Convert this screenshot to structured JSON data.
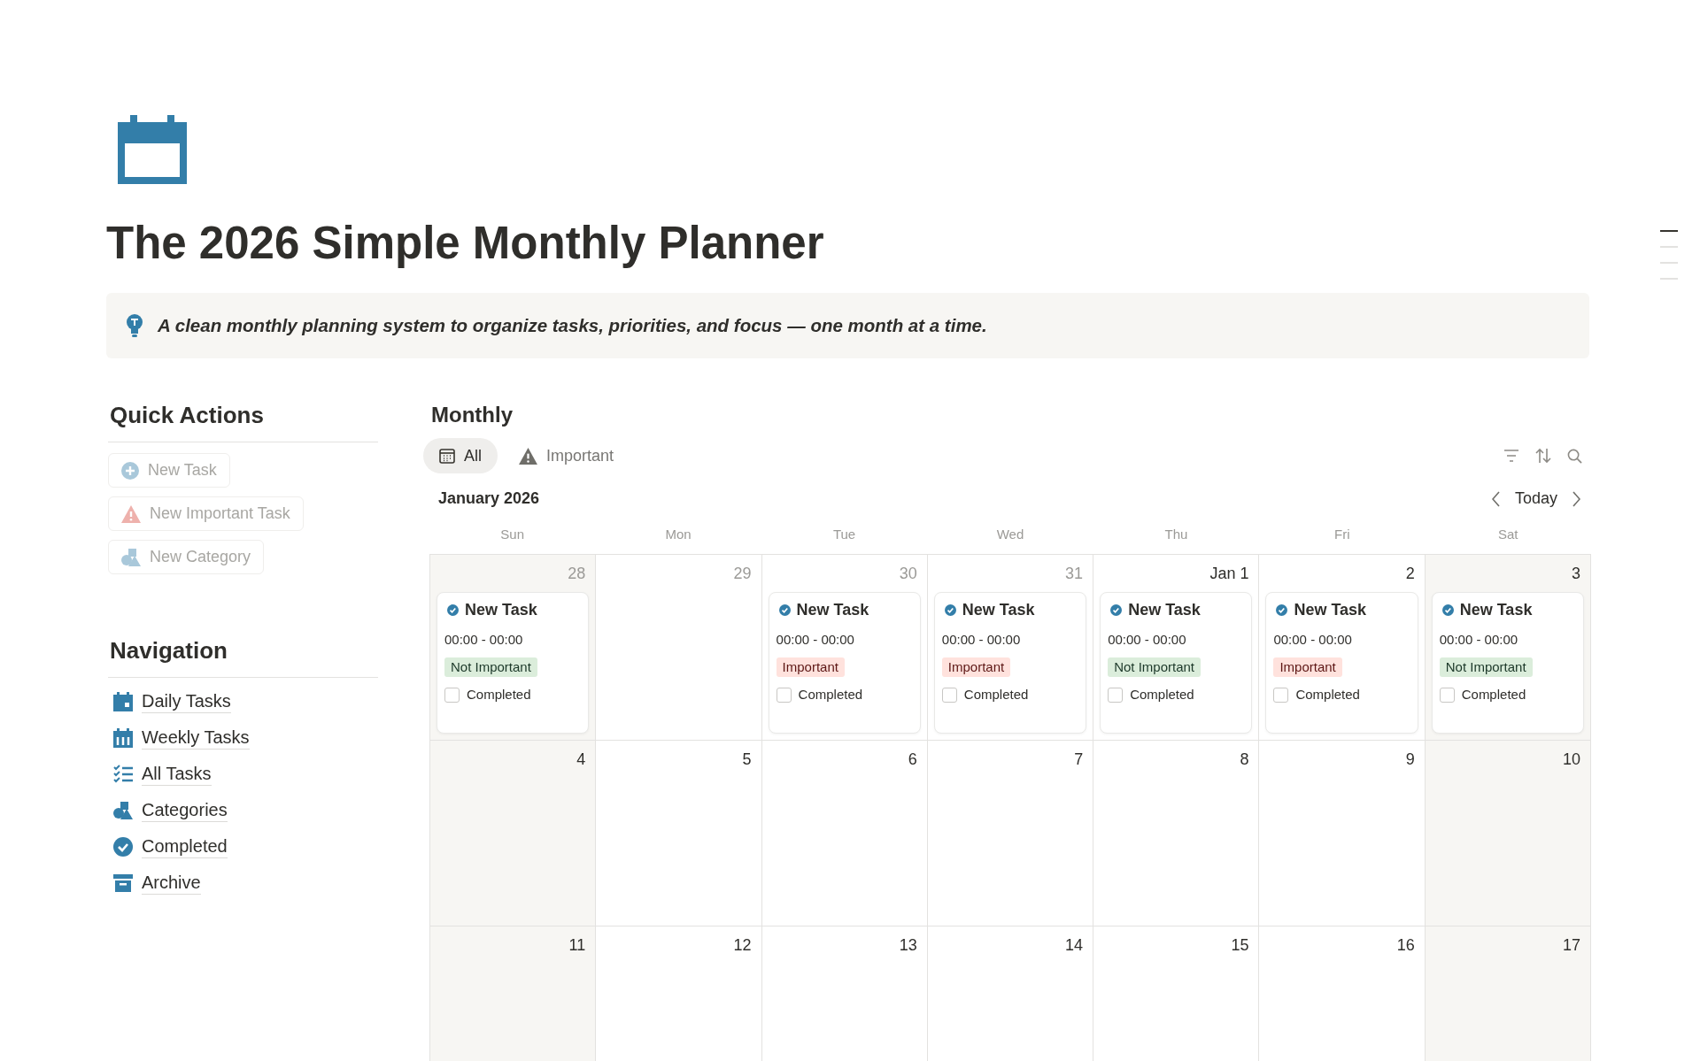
{
  "page": {
    "title": "The 2026 Simple Monthly Planner",
    "callout": "A clean monthly planning system to organize tasks, priorities, and focus — one month at a time."
  },
  "quick_actions": {
    "heading": "Quick Actions",
    "buttons": [
      {
        "label": "New Task",
        "kind": "plus"
      },
      {
        "label": "New Important Task",
        "kind": "warning"
      },
      {
        "label": "New Category",
        "kind": "shapes"
      }
    ]
  },
  "navigation": {
    "heading": "Navigation",
    "items": [
      {
        "label": "Daily Tasks",
        "kind": "day"
      },
      {
        "label": "Weekly Tasks",
        "kind": "week"
      },
      {
        "label": "All Tasks",
        "kind": "list"
      },
      {
        "label": "Categories",
        "kind": "shapes"
      },
      {
        "label": "Completed",
        "kind": "check"
      },
      {
        "label": "Archive",
        "kind": "archive"
      }
    ]
  },
  "calendar": {
    "title": "Monthly",
    "views": [
      {
        "label": "All",
        "kind": "calendar",
        "selected": true
      },
      {
        "label": "Important",
        "kind": "warning",
        "selected": false
      }
    ],
    "month": "January 2026",
    "today_button": "Today",
    "weekdays": [
      {
        "label": "Sun",
        "weekend": true
      },
      {
        "label": "Mon",
        "weekend": false
      },
      {
        "label": "Tue",
        "weekend": false
      },
      {
        "label": "Wed",
        "weekend": false
      },
      {
        "label": "Thu",
        "weekend": false
      },
      {
        "label": "Fri",
        "weekend": false
      },
      {
        "label": "Sat",
        "weekend": true
      }
    ],
    "weeks": [
      [
        {
          "date": "28",
          "outside": true,
          "tasks": [
            {
              "title": "New Task",
              "time": "00:00 - 00:00",
              "tag": {
                "label": "Not Important",
                "color": "#dbeddb"
              },
              "checkbox_label": "Completed",
              "checked": false
            }
          ]
        },
        {
          "date": "29",
          "outside": true
        },
        {
          "date": "30",
          "outside": true,
          "tasks": [
            {
              "title": "New Task",
              "time": "00:00 - 00:00",
              "tag": {
                "label": "Important",
                "color": "#ffe2dd"
              },
              "checkbox_label": "Completed",
              "checked": false
            }
          ]
        },
        {
          "date": "31",
          "outside": true,
          "tasks": [
            {
              "title": "New Task",
              "time": "00:00 - 00:00",
              "tag": {
                "label": "Important",
                "color": "#ffe2dd"
              },
              "checkbox_label": "Completed",
              "checked": false
            }
          ]
        },
        {
          "date": "Jan 1",
          "outside": false,
          "tasks": [
            {
              "title": "New Task",
              "time": "00:00 - 00:00",
              "tag": {
                "label": "Not Important",
                "color": "#dbeddb"
              },
              "checkbox_label": "Completed",
              "checked": false
            }
          ]
        },
        {
          "date": "2",
          "outside": false,
          "tasks": [
            {
              "title": "New Task",
              "time": "00:00 - 00:00",
              "tag": {
                "label": "Important",
                "color": "#ffe2dd"
              },
              "checkbox_label": "Completed",
              "checked": false
            }
          ]
        },
        {
          "date": "3",
          "outside": false,
          "tasks": [
            {
              "title": "New Task",
              "time": "00:00 - 00:00",
              "tag": {
                "label": "Not Important",
                "color": "#dbeddb"
              },
              "checkbox_label": "Completed",
              "checked": false
            }
          ]
        }
      ],
      [
        {
          "date": "4",
          "outside": false
        },
        {
          "date": "5",
          "outside": false
        },
        {
          "date": "6",
          "outside": false
        },
        {
          "date": "7",
          "outside": false
        },
        {
          "date": "8",
          "outside": false
        },
        {
          "date": "9",
          "outside": false
        },
        {
          "date": "10",
          "outside": false
        }
      ],
      [
        {
          "date": "11",
          "outside": false
        },
        {
          "date": "12",
          "outside": false
        },
        {
          "date": "13",
          "outside": false
        },
        {
          "date": "14",
          "outside": false
        },
        {
          "date": "15",
          "outside": false
        },
        {
          "date": "16",
          "outside": false
        },
        {
          "date": "17",
          "outside": false
        }
      ]
    ]
  },
  "toc": [
    {
      "selected": true
    },
    {
      "selected": false
    },
    {
      "selected": false
    },
    {
      "selected": false
    }
  ]
}
